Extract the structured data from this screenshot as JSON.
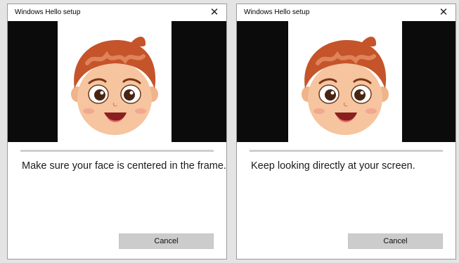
{
  "dialogs": [
    {
      "title": "Windows Hello setup",
      "close_glyph": "✕",
      "progress_fraction": 0,
      "message": "Make sure your face is centered in the frame.",
      "cancel_label": "Cancel"
    },
    {
      "title": "Windows Hello setup",
      "close_glyph": "✕",
      "progress_fraction": 0,
      "message": "Keep looking directly at your screen.",
      "cancel_label": "Cancel"
    }
  ],
  "colors": {
    "camera_background": "#0b0b0b",
    "hair": "#c5542a",
    "skin": "#f4c19a",
    "progress_track": "#cfcfcf",
    "button": "#cccccc"
  },
  "icons": [
    "close-icon",
    "cartoon-face-image"
  ]
}
